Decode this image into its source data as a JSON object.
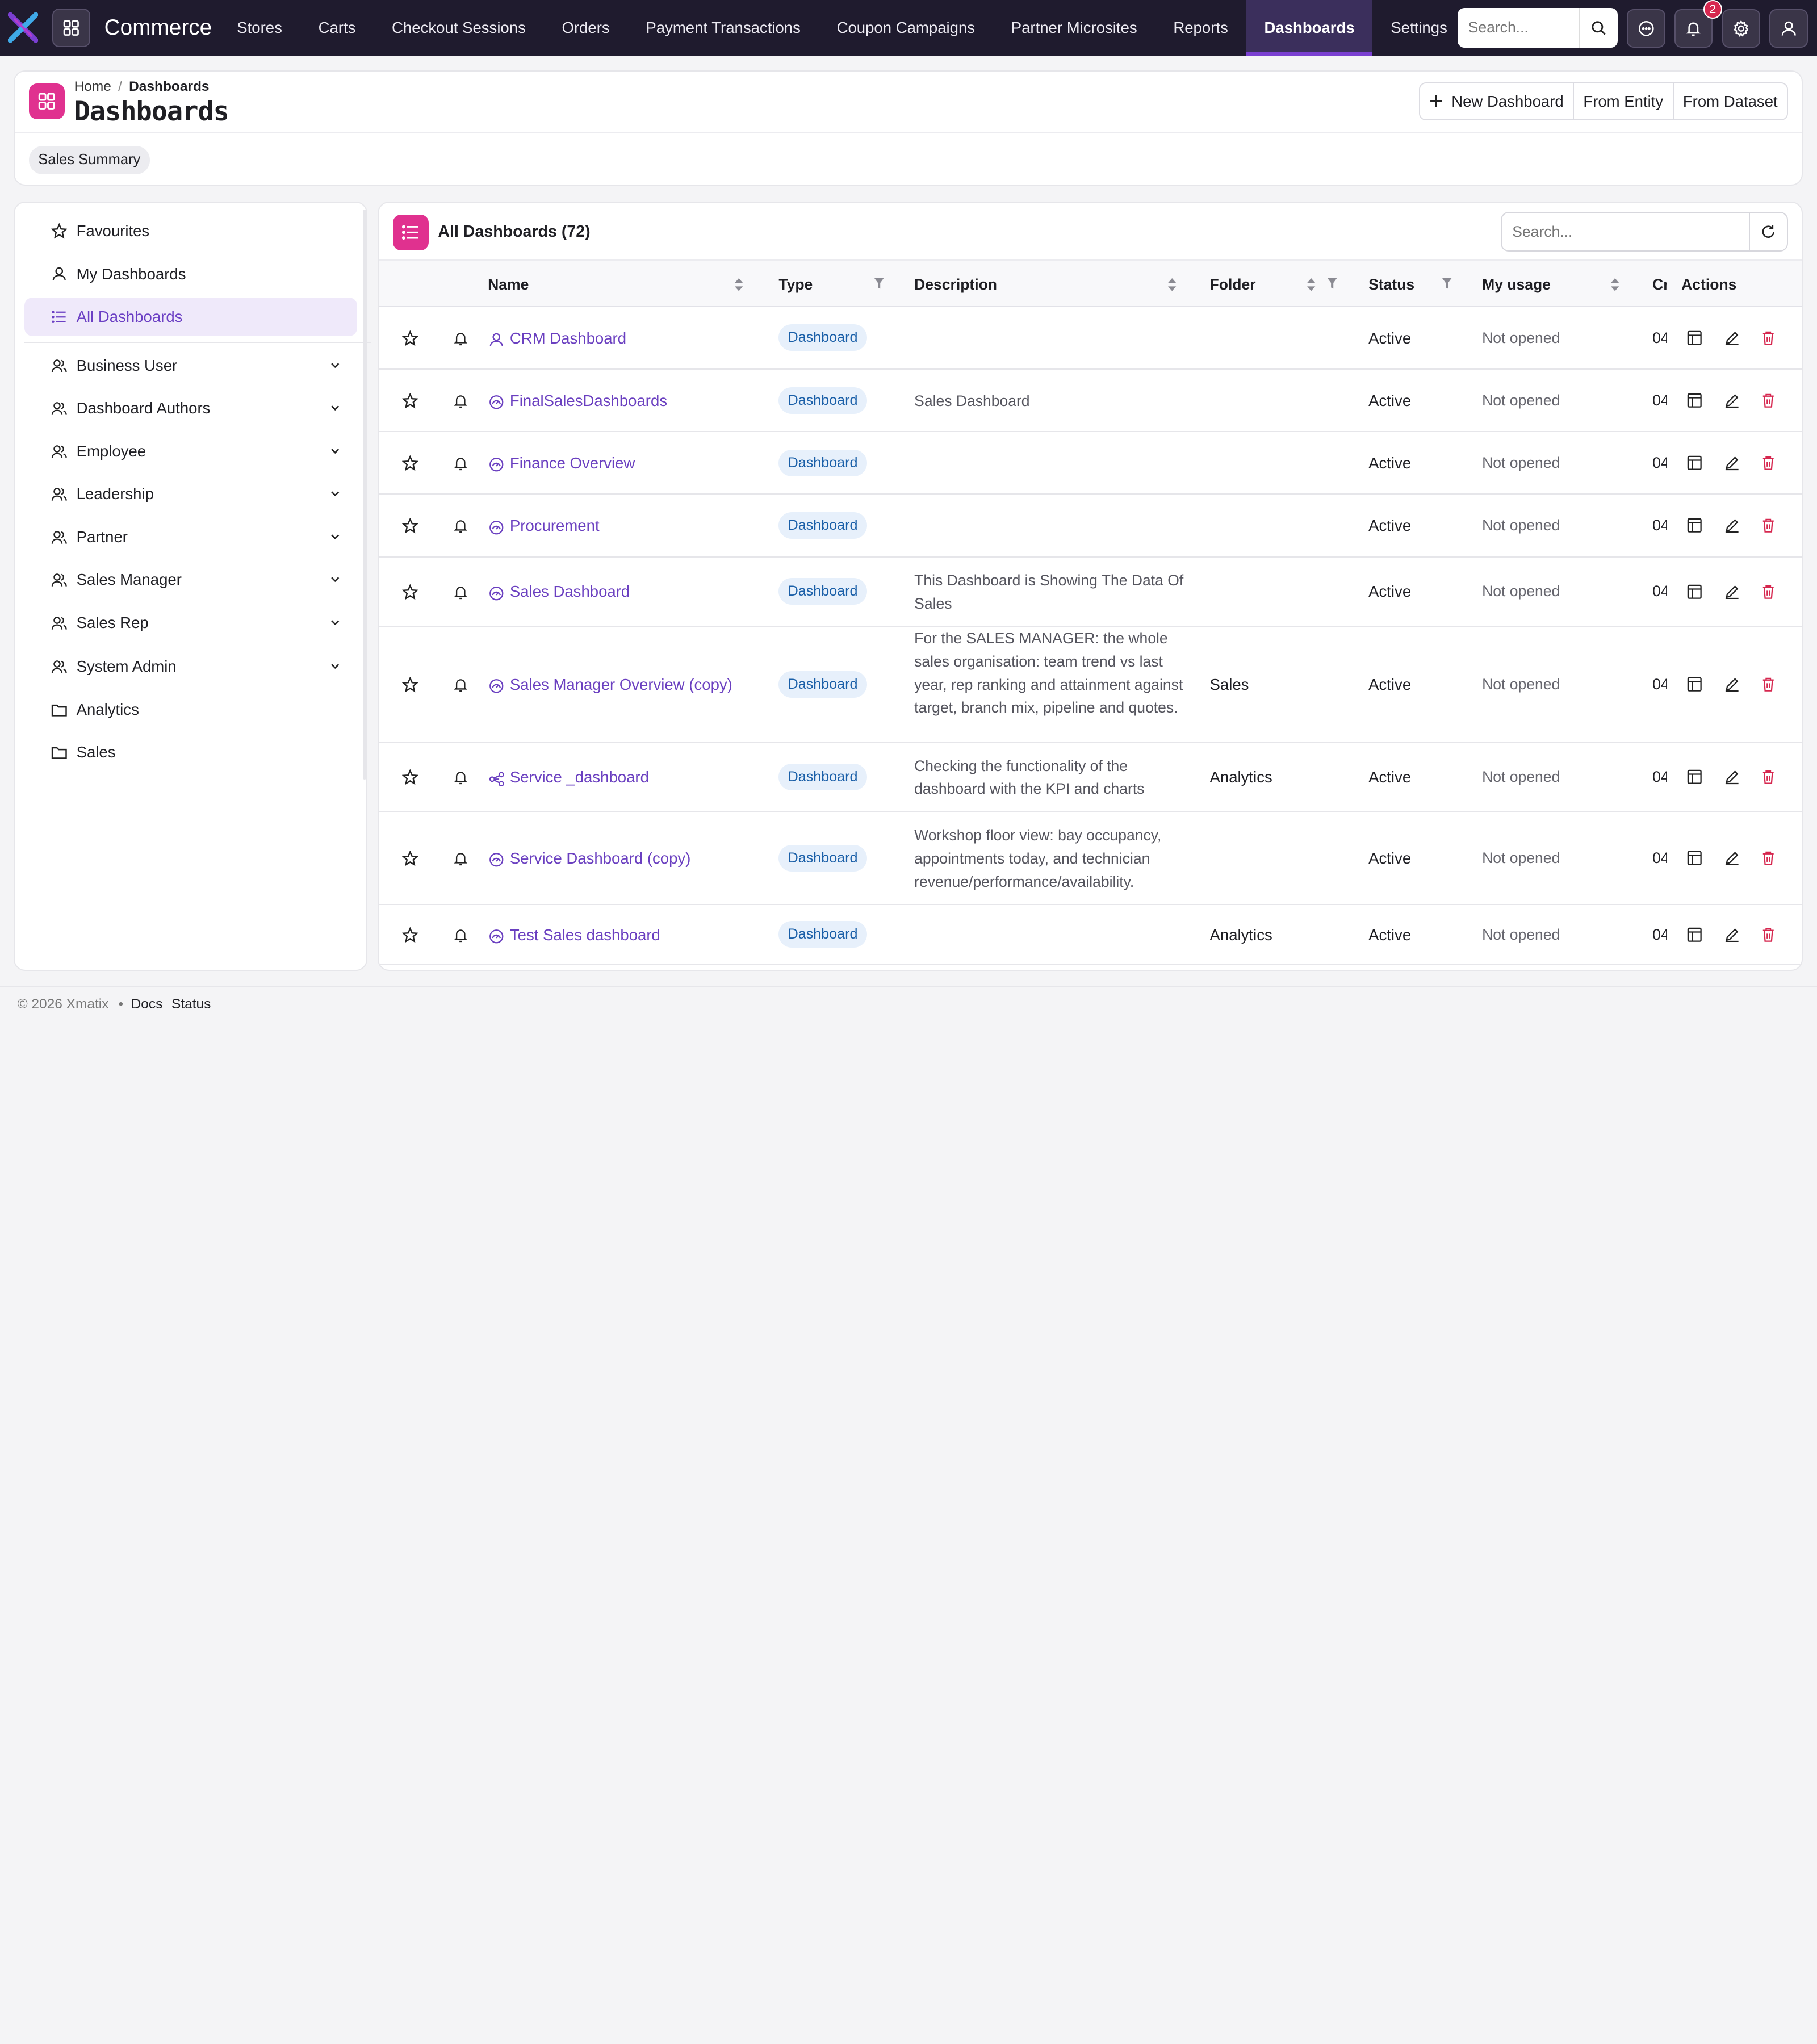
{
  "app": {
    "brand": "Commerce"
  },
  "nav": {
    "items": [
      {
        "label": "Stores",
        "active": false
      },
      {
        "label": "Carts",
        "active": false
      },
      {
        "label": "Checkout Sessions",
        "active": false
      },
      {
        "label": "Orders",
        "active": false
      },
      {
        "label": "Payment Transactions",
        "active": false
      },
      {
        "label": "Coupon Campaigns",
        "active": false
      },
      {
        "label": "Partner Microsites",
        "active": false
      },
      {
        "label": "Reports",
        "active": false
      },
      {
        "label": "Dashboards",
        "active": true
      },
      {
        "label": "Settings",
        "active": false
      }
    ],
    "search_placeholder": "Search...",
    "notification_count": "2"
  },
  "header": {
    "breadcrumb_home": "Home",
    "breadcrumb_sep": "/",
    "breadcrumb_current": "Dashboards",
    "title": "Dashboards",
    "actions": {
      "new_dashboard": "New Dashboard",
      "from_entity": "From Entity",
      "from_dataset": "From Dataset"
    },
    "chip": "Sales Summary"
  },
  "sidebar": {
    "items": [
      {
        "label": "Favourites",
        "icon": "star-icon",
        "active": false
      },
      {
        "label": "My Dashboards",
        "icon": "user-icon",
        "active": false
      },
      {
        "label": "All Dashboards",
        "icon": "list-icon",
        "active": true
      }
    ],
    "groups": [
      {
        "label": "Business User",
        "icon": "users-icon"
      },
      {
        "label": "Dashboard Authors",
        "icon": "users-icon"
      },
      {
        "label": "Employee",
        "icon": "users-icon"
      },
      {
        "label": "Leadership",
        "icon": "users-icon"
      },
      {
        "label": "Partner",
        "icon": "users-icon"
      },
      {
        "label": "Sales Manager",
        "icon": "users-icon"
      },
      {
        "label": "Sales Rep",
        "icon": "users-icon"
      },
      {
        "label": "System Admin",
        "icon": "users-icon"
      }
    ],
    "folders": [
      {
        "label": "Analytics",
        "icon": "folder-icon"
      },
      {
        "label": "Sales",
        "icon": "folder-icon"
      }
    ]
  },
  "main": {
    "title": "All Dashboards (72)",
    "search_placeholder": "Search...",
    "columns": {
      "name": "Name",
      "type": "Type",
      "description": "Description",
      "folder": "Folder",
      "status": "Status",
      "usage": "My usage",
      "created": "Cr",
      "actions": "Actions"
    },
    "rows": [
      {
        "name": "CRM Dashboard",
        "icon": "user-icon",
        "type": "Dashboard",
        "description": "",
        "folder": "",
        "status": "Active",
        "usage": "Not opened",
        "created": "04"
      },
      {
        "name": "FinalSalesDashboards",
        "icon": "gauge-icon",
        "type": "Dashboard",
        "description": "Sales Dashboard",
        "folder": "",
        "status": "Active",
        "usage": "Not opened",
        "created": "04"
      },
      {
        "name": "Finance Overview",
        "icon": "gauge-icon",
        "type": "Dashboard",
        "description": "",
        "folder": "",
        "status": "Active",
        "usage": "Not opened",
        "created": "04"
      },
      {
        "name": "Procurement",
        "icon": "gauge-icon",
        "type": "Dashboard",
        "description": "",
        "folder": "",
        "status": "Active",
        "usage": "Not opened",
        "created": "04"
      },
      {
        "name": "Sales Dashboard",
        "icon": "gauge-icon",
        "type": "Dashboard",
        "description": "This Dashboard is Showing The Data Of Sales",
        "folder": "",
        "status": "Active",
        "usage": "Not opened",
        "created": "04"
      },
      {
        "name": "Sales Manager Overview (copy)",
        "icon": "gauge-icon",
        "type": "Dashboard",
        "description": "For the SALES MANAGER: the whole sales organisation: team trend vs last year, rep ranking and attainment against target, branch mix, pipeline and quotes.",
        "folder": "Sales",
        "status": "Active",
        "usage": "Not opened",
        "created": "04"
      },
      {
        "name": "Service _dashboard",
        "icon": "share-nodes-icon",
        "type": "Dashboard",
        "description": "Checking the functionality of the dashboard with the KPI and charts",
        "folder": "Analytics",
        "status": "Active",
        "usage": "Not opened",
        "created": "04"
      },
      {
        "name": "Service Dashboard (copy)",
        "icon": "gauge-icon",
        "type": "Dashboard",
        "description": "Workshop floor view: bay occupancy, appointments today, and technician revenue/performance/availability.",
        "folder": "",
        "status": "Active",
        "usage": "Not opened",
        "created": "04"
      },
      {
        "name": "Test Sales dashboard",
        "icon": "gauge-icon",
        "type": "Dashboard",
        "description": "",
        "folder": "Analytics",
        "status": "Active",
        "usage": "Not opened",
        "created": "04"
      }
    ]
  },
  "footer": {
    "copyright": "© 2026 Xmatix",
    "dot": "•",
    "docs": "Docs",
    "status": "Status"
  },
  "colors": {
    "nav_bg": "#1f1b2e",
    "accent": "#7a3fd1",
    "pink": "#e0318f",
    "link": "#6a3fc0",
    "delete": "#d6274f"
  }
}
